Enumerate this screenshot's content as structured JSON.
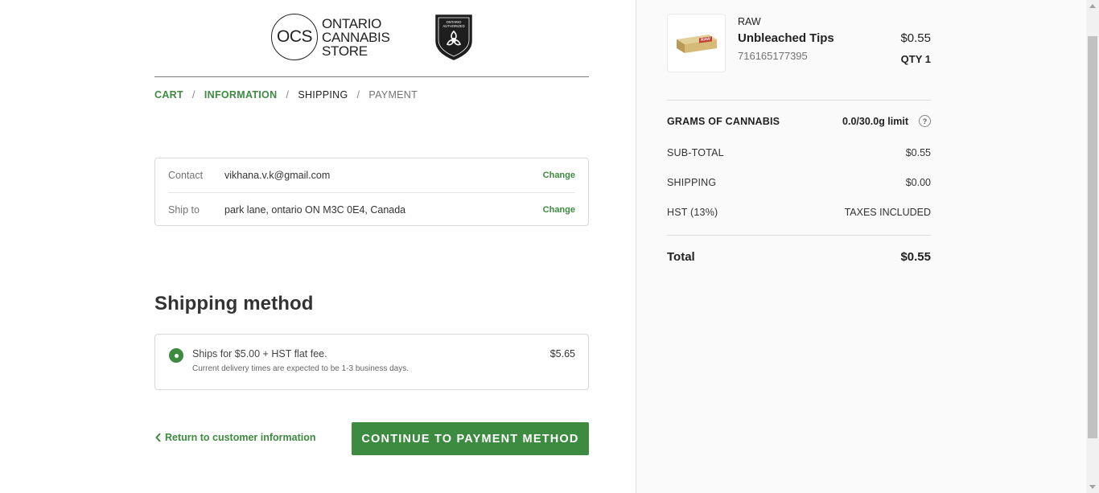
{
  "header": {
    "logo_mark": "OCS",
    "logo_lines": [
      "ONTARIO",
      "CANNABIS",
      "STORE"
    ],
    "badge_text": [
      "ONTARIO",
      "AUTHORIZED"
    ]
  },
  "breadcrumb": {
    "items": [
      {
        "label": "CART",
        "state": "done"
      },
      {
        "label": "INFORMATION",
        "state": "done"
      },
      {
        "label": "SHIPPING",
        "state": "current"
      },
      {
        "label": "PAYMENT",
        "state": "pending"
      }
    ],
    "separator": "/"
  },
  "review": {
    "contact": {
      "label": "Contact",
      "value": "vikhana.v.k@gmail.com",
      "action": "Change"
    },
    "ship_to": {
      "label": "Ship to",
      "value": "park lane, ontario ON M3C 0E4, Canada",
      "action": "Change"
    }
  },
  "shipping_method": {
    "title": "Shipping method",
    "option": {
      "label": "Ships for $5.00 + HST flat fee.",
      "note": "Current delivery times are expected to be 1-3 business days.",
      "price": "$5.65",
      "selected": true
    }
  },
  "actions": {
    "return_label": "Return to customer information",
    "continue_label": "CONTINUE TO PAYMENT METHOD"
  },
  "summary": {
    "product": {
      "brand": "RAW",
      "name": "Unbleached Tips",
      "sku": "716165177395",
      "price": "$0.55",
      "qty": "QTY 1",
      "thumb_label": "RAW"
    },
    "grams": {
      "label": "GRAMS OF CANNABIS",
      "value": "0.0/30.0g limit",
      "help": "?"
    },
    "subtotal": {
      "label": "SUB-TOTAL",
      "value": "$0.55"
    },
    "shipping": {
      "label": "SHIPPING",
      "value": "$0.00"
    },
    "tax": {
      "label": "HST (13%)",
      "value": "TAXES INCLUDED"
    },
    "total": {
      "label": "Total",
      "value": "$0.55"
    }
  },
  "colors": {
    "accent": "#3d8b40",
    "sidebar_bg": "#fafafa",
    "border": "#d9d9d9"
  }
}
